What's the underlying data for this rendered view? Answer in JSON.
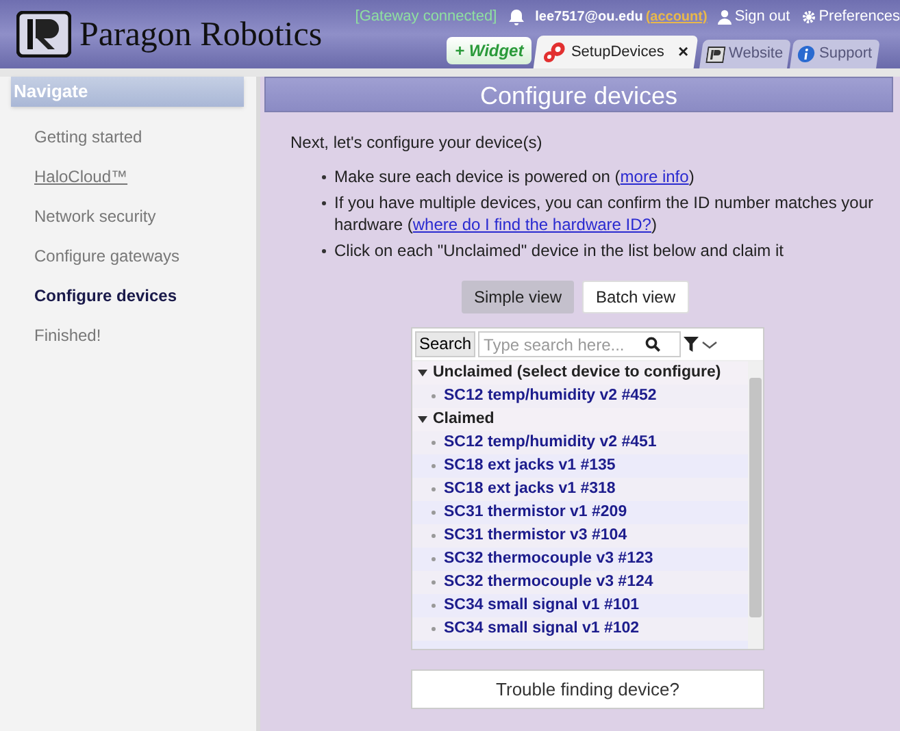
{
  "header": {
    "logo_text": "Paragon Robotics",
    "gateway_status": "[Gateway connected]",
    "user_email": "lee7517@ou.edu",
    "account_link": "(account)",
    "sign_out": "Sign out",
    "preferences": "Preferences"
  },
  "tabs": [
    {
      "kind": "widget",
      "label": "+ Widget",
      "selected": false
    },
    {
      "kind": "page",
      "label": "SetupDevices",
      "selected": true,
      "close": "×"
    },
    {
      "kind": "page",
      "label": "Website",
      "selected": false
    },
    {
      "kind": "info",
      "label": "Support",
      "selected": false
    }
  ],
  "sidebar": {
    "title": "Navigate",
    "items": [
      {
        "label": "Getting started",
        "selected": false,
        "link": false
      },
      {
        "label": "HaloCloud™",
        "selected": false,
        "link": true
      },
      {
        "label": "Network security",
        "selected": false,
        "link": false
      },
      {
        "label": "Configure gateways",
        "selected": false,
        "link": false
      },
      {
        "label": "Configure devices",
        "selected": true,
        "link": false
      },
      {
        "label": "Finished!",
        "selected": false,
        "link": false
      }
    ]
  },
  "main": {
    "title": "Configure devices",
    "intro": "Next, let's configure your device(s)",
    "bullets": [
      {
        "text": "Make sure each device is powered on (",
        "link": "more info",
        "after": ")"
      },
      {
        "text": "If you have multiple devices, you can confirm the ID number matches your hardware (",
        "link": "where do I find the hardware ID?",
        "after": ")"
      },
      {
        "text": "Click on each \"Unclaimed\" device in the list below and claim it"
      }
    ],
    "view_buttons": [
      {
        "label": "Simple view",
        "selected": true
      },
      {
        "label": "Batch view",
        "selected": false
      }
    ],
    "search": {
      "button": "Search",
      "placeholder": "Type search here..."
    },
    "groups": [
      {
        "label": "Unclaimed (select device to configure)",
        "expanded": true,
        "children": [
          {
            "label": "SC12 temp/humidity v2 #452"
          }
        ]
      },
      {
        "label": "Claimed",
        "expanded": true,
        "children": [
          {
            "label": "SC12 temp/humidity v2 #451"
          },
          {
            "label": "SC18 ext jacks v1 #135"
          },
          {
            "label": "SC18 ext jacks v1 #318"
          },
          {
            "label": "SC31 thermistor v1 #209"
          },
          {
            "label": "SC31 thermistor v3 #104"
          },
          {
            "label": "SC32 thermocouple v3 #123"
          },
          {
            "label": "SC32 thermocouple v3 #124"
          },
          {
            "label": "SC34 small signal v1 #101"
          },
          {
            "label": "SC34 small signal v1 #102"
          }
        ]
      }
    ],
    "trouble_button": "Trouble finding device?"
  }
}
